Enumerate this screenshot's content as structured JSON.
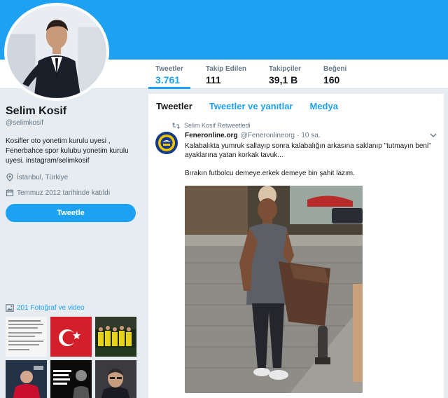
{
  "profile": {
    "name": "Selim Kosif",
    "handle": "@selimkosif",
    "bio": "Kosifler oto yonetim kurulu uyesi , Fenerbahce spor kulubu yonetim kurulu uyesi. instagram/selimkosif",
    "location": "İstanbul, Türkiye",
    "joined": "Temmuz 2012 tarihinde katıldı",
    "tweet_button": "Tweetle"
  },
  "stats": [
    {
      "label": "Tweetler",
      "value": "3.761"
    },
    {
      "label": "Takip Edilen",
      "value": "111"
    },
    {
      "label": "Takipçiler",
      "value": "39,1 B"
    },
    {
      "label": "Beğeni",
      "value": "160"
    }
  ],
  "photos": {
    "header": "201 Fotoğraf ve video"
  },
  "timeline": {
    "tabs": [
      "Tweetler",
      "Tweetler ve yanıtlar",
      "Medya"
    ],
    "tweet": {
      "retweet_note": "Selim Kosif Retweetledi",
      "author_name": "Feneronline.org",
      "author_handle": "@Feneronlineorg",
      "separator": "·",
      "time": "10 sa.",
      "text_line1": "Kalabalıkta yumruk sallayıp sonra kalabalığın arkasına saklanıp \"tutmayın beni\" ayaklarına yatan korkak tavuk...",
      "text_line2": "Bırakın futbolcu demeye.erkek demeye bin şahit lazım."
    }
  },
  "colors": {
    "accent": "#1da1f2",
    "background": "#e6ecf0",
    "text_secondary": "#657786"
  },
  "icons": [
    "location-icon",
    "calendar-icon",
    "photo-icon",
    "retweet-icon",
    "chevron-down-icon"
  ]
}
